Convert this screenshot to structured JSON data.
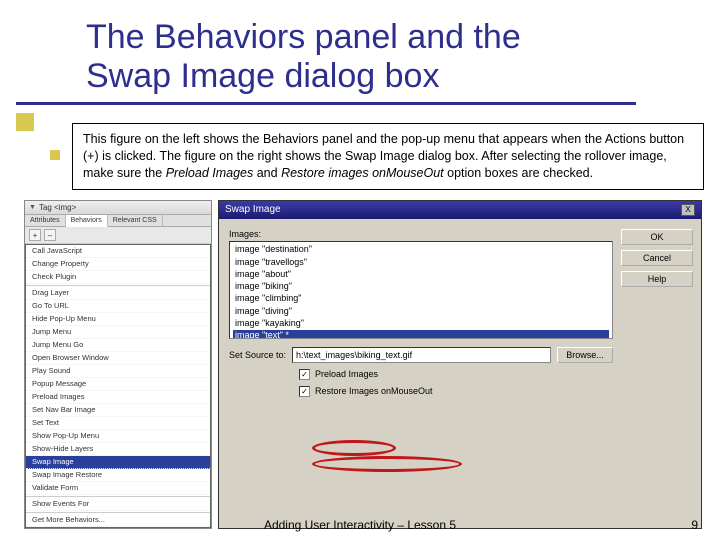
{
  "title_line1": "The Behaviors panel and the",
  "title_line2": "Swap Image dialog box",
  "paragraph": {
    "p1": "This figure on the left shows the Behaviors panel and the pop-up menu that appears when the Actions button (+) is clicked. The figure on the right shows the Swap Image dialog box. After selecting the rollover image, make sure the ",
    "i1": "Preload Images",
    "mid": " and ",
    "i2": "Restore images onMouseOut",
    "p2": " option boxes are checked."
  },
  "behaviors": {
    "window_title": "Tag <img>",
    "tabs": [
      "Attributes",
      "Behaviors",
      "Relevant CSS"
    ],
    "plus": "+",
    "minus": "–",
    "menu": [
      "Call JavaScript",
      "Change Property",
      "Check Plugin",
      "__hr__",
      "Drag Layer",
      "Go To URL",
      "Hide Pop-Up Menu",
      "Jump Menu",
      "Jump Menu Go",
      "Open Browser Window",
      "Play Sound",
      "Popup Message",
      "Preload Images",
      "Set Nav Bar Image",
      "Set Text",
      "Show Pop-Up Menu",
      "Show-Hide Layers",
      "Swap Image",
      "Swap Image Restore",
      "Validate Form",
      "__hr__",
      "Show Events For",
      "__hr__",
      "Get More Behaviors..."
    ],
    "highlight": "Swap Image"
  },
  "swap": {
    "title": "Swap Image",
    "close": "X",
    "images_label": "Images:",
    "images": [
      "image \"destination\"",
      "image \"travellogs\"",
      "image \"about\"",
      "image \"biking\"",
      "image \"climbing\"",
      "image \"diving\"",
      "image \"kayaking\"",
      "image \"text\" *"
    ],
    "selected_image": "image \"text\" *",
    "source_label": "Set Source to:",
    "source_value": "h:\\text_images\\biking_text.gif",
    "browse": "Browse...",
    "check1": "Preload Images",
    "check2": "Restore Images onMouseOut",
    "checkmark": "✓",
    "buttons": {
      "ok": "OK",
      "cancel": "Cancel",
      "help": "Help"
    }
  },
  "footer": "Adding User Interactivity – Lesson 5",
  "page": "9"
}
